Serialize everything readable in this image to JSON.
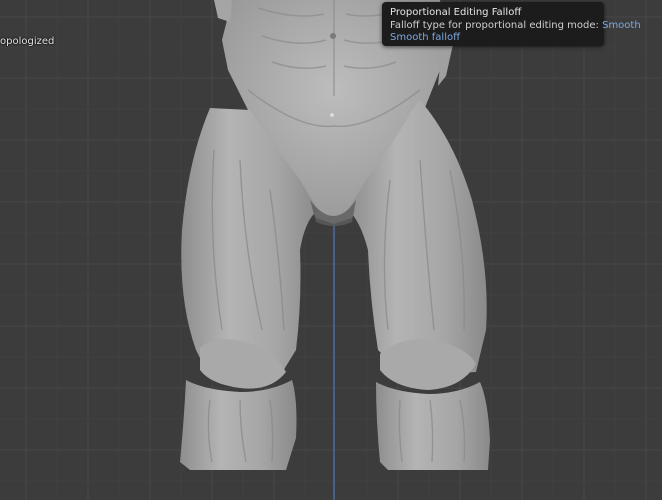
{
  "viewport": {
    "object_label": "opologized"
  },
  "tooltip": {
    "title": "Proportional Editing Falloff",
    "description": "Falloff type for proportional editing mode:",
    "value": "Smooth",
    "subtitle": "Smooth falloff"
  },
  "colors": {
    "background": "#3c3c3c",
    "grid_line": "#4a4a4a",
    "axis_z": "#4f78b8",
    "tooltip_bg": "#1c1c1c",
    "tooltip_accent": "#7fa8df",
    "mesh": "#a9a9a9"
  }
}
